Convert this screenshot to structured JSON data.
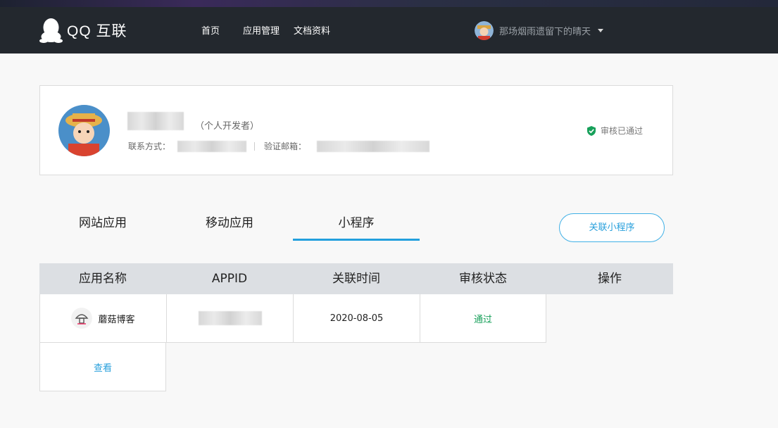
{
  "header": {
    "logo_text": "QQ 互联",
    "nav": [
      {
        "label": "首页"
      },
      {
        "label": "应用管理"
      },
      {
        "label": "文档资料"
      }
    ],
    "user_name": "那场烟雨遗留下的晴天"
  },
  "profile": {
    "developer_type": "（个人开发者）",
    "contact_label": "联系方式：",
    "email_label": "验证邮箱：",
    "status": "审核已通过"
  },
  "tabs": [
    {
      "label": "网站应用"
    },
    {
      "label": "移动应用"
    },
    {
      "label": "小程序",
      "active": true
    }
  ],
  "link_button": "关联小程序",
  "table": {
    "headers": [
      "应用名称",
      "APPID",
      "关联时间",
      "审核状态",
      "操作"
    ],
    "rows": [
      {
        "name": "蘑菇博客",
        "appid": "",
        "time": "2020-08-05",
        "status": "通过",
        "action": "查看"
      }
    ]
  },
  "colors": {
    "header_bg": "#23282e",
    "accent": "#23a0dd",
    "success": "#17a05a"
  }
}
